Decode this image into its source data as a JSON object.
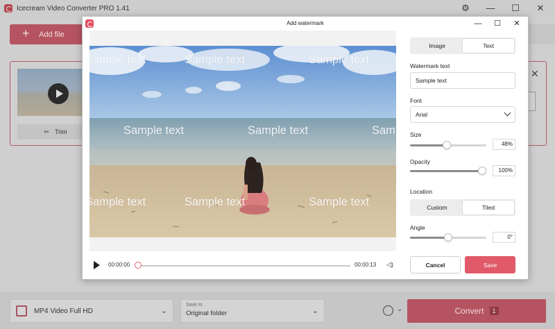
{
  "app": {
    "title": "Icecream Video Converter PRO 1.41",
    "add_file_label": "Add file",
    "trim_label": "Trim",
    "format_label": "MP4 Video Full HD",
    "save_to_label": "Save to",
    "save_to_value": "Original folder",
    "convert_label": "Convert",
    "convert_count": "1"
  },
  "dialog": {
    "title": "Add watermark",
    "tabs": [
      {
        "label": "Image",
        "active": false
      },
      {
        "label": "Text",
        "active": true
      }
    ],
    "watermark_text_label": "Watermark text",
    "watermark_text_value": "Sample text",
    "font_label": "Font",
    "font_value": "Arial",
    "size_label": "Size",
    "size_value": "48%",
    "size_fraction": 0.48,
    "opacity_label": "Opacity",
    "opacity_value": "100%",
    "opacity_fraction": 1.0,
    "location_label": "Location",
    "location_options": [
      {
        "label": "Custom",
        "active": false
      },
      {
        "label": "Tiled",
        "active": true
      }
    ],
    "angle_label": "Angle",
    "angle_value": "0°",
    "angle_fraction": 0.5,
    "cancel_label": "Cancel",
    "save_label": "Save"
  },
  "player": {
    "current_time": "00:00:00",
    "end_time": "00:00:13",
    "progress_fraction": 0.0
  },
  "watermarks": [
    "Sample text",
    "Sample text",
    "Sample text",
    "Sample text",
    "Sample text",
    "Sample text",
    "Sample text",
    "Sample text",
    "Sample text"
  ]
}
